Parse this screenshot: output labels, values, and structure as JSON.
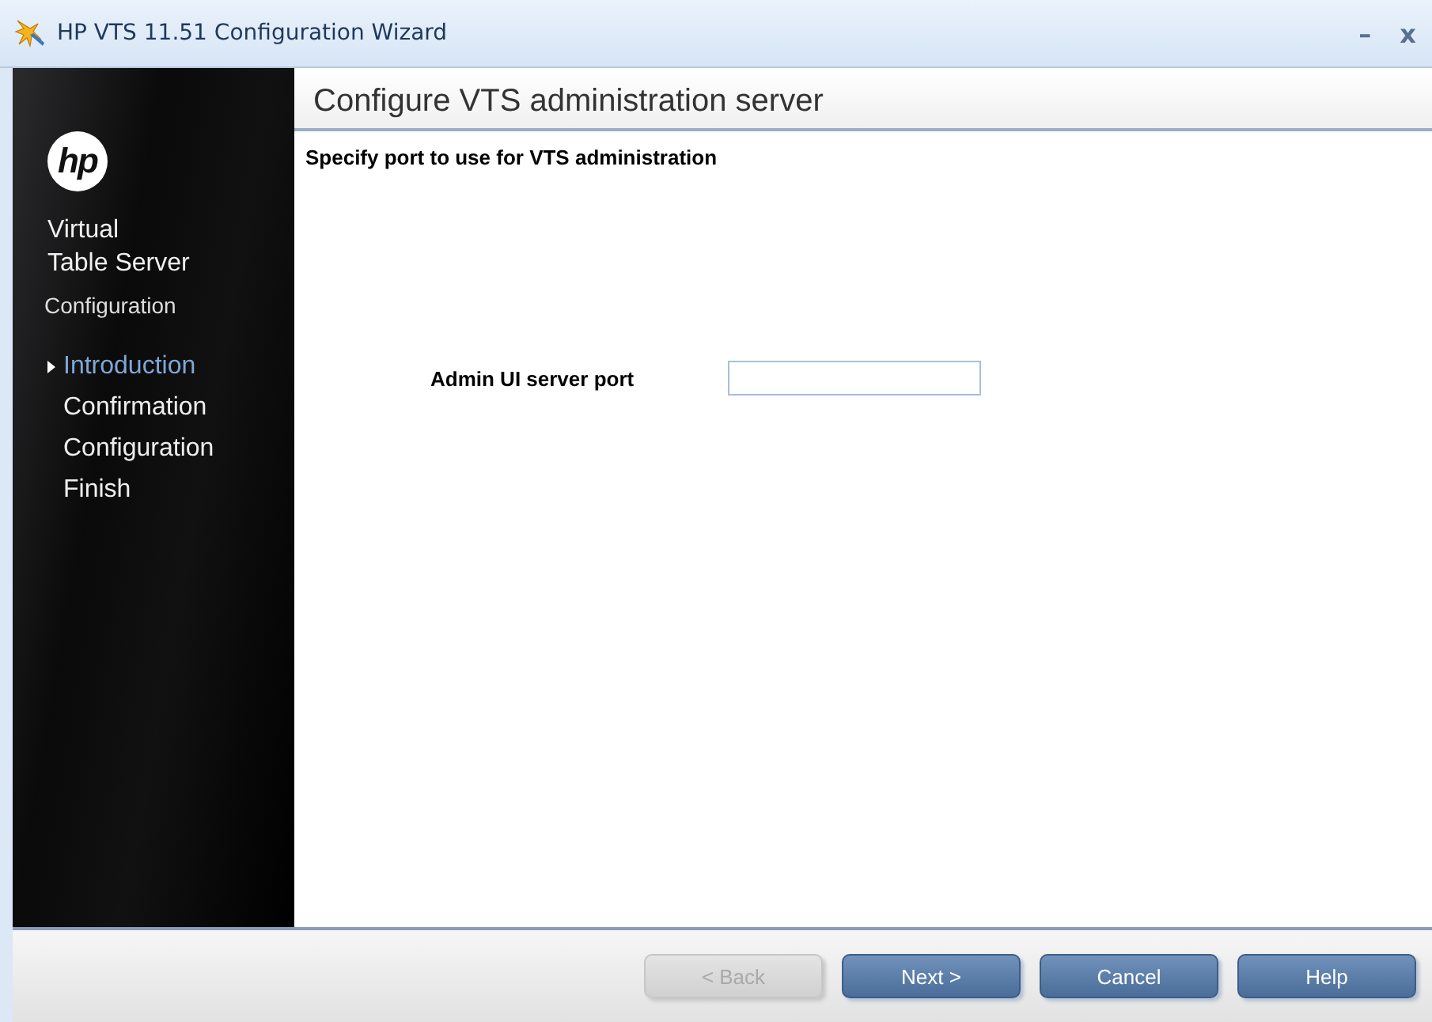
{
  "window": {
    "title": "HP VTS 11.51 Configuration Wizard",
    "controls": [
      "–",
      "x"
    ]
  },
  "sidebar": {
    "logo": "hp",
    "product": [
      "Virtual",
      "Table Server"
    ],
    "subtitle": "Configuration",
    "steps": [
      {
        "label": "Introduction",
        "selected": true
      },
      {
        "label": "Confirmation",
        "selected": false
      },
      {
        "label": "Configuration",
        "selected": false
      },
      {
        "label": "Finish",
        "selected": false
      }
    ]
  },
  "page": {
    "heading": "Configure VTS administration server",
    "instruction": "Specify port to use for VTS administration",
    "fields": [
      {
        "label": "Admin UI server port"
      }
    ]
  },
  "buttons": [
    {
      "label": "< Back",
      "disabled": true
    },
    {
      "label": "Next >",
      "disabled": false
    },
    {
      "label": "Cancel",
      "disabled": false
    },
    {
      "label": "Help",
      "disabled": false
    }
  ]
}
